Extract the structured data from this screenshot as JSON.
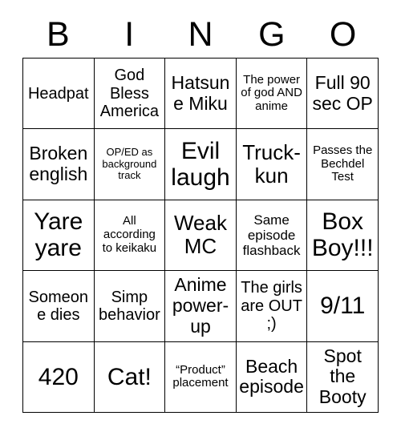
{
  "card": {
    "header_letters": [
      "B",
      "I",
      "N",
      "G",
      "O"
    ],
    "background_color": "#ffffff",
    "text_color": "#000000",
    "border_color": "#000000",
    "rows": 5,
    "columns": 5,
    "cells": [
      {
        "text": "Headpat",
        "size": "m"
      },
      {
        "text": "God Bless America",
        "size": "m"
      },
      {
        "text": "Hatsune Miku",
        "size": "l"
      },
      {
        "text": "The power of god AND anime",
        "size": "xs"
      },
      {
        "text": "Full 90 sec OP",
        "size": "l"
      },
      {
        "text": "Broken english",
        "size": "l"
      },
      {
        "text": "OP/ED as background track",
        "size": "xxs"
      },
      {
        "text": "Evil laugh",
        "size": "xxl"
      },
      {
        "text": "Truck-kun",
        "size": "xl"
      },
      {
        "text": "Passes the Bechdel Test",
        "size": "xs"
      },
      {
        "text": "Yare yare",
        "size": "xxl"
      },
      {
        "text": "All according to keikaku",
        "size": "xs"
      },
      {
        "text": "Weak MC",
        "size": "xl"
      },
      {
        "text": "Same episode flashback",
        "size": "s"
      },
      {
        "text": "Box Boy!!!",
        "size": "xxl"
      },
      {
        "text": "Someone dies",
        "size": "m"
      },
      {
        "text": "Simp behavior",
        "size": "m"
      },
      {
        "text": "Anime power-up",
        "size": "l"
      },
      {
        "text": "The girls are OUT ;)",
        "size": "m"
      },
      {
        "text": "9/11",
        "size": "xxl"
      },
      {
        "text": "420",
        "size": "xxl"
      },
      {
        "text": "Cat!",
        "size": "xxl"
      },
      {
        "text": "“Product” placement",
        "size": "xs"
      },
      {
        "text": "Beach episode",
        "size": "l"
      },
      {
        "text": "Spot the Booty",
        "size": "l"
      }
    ]
  }
}
